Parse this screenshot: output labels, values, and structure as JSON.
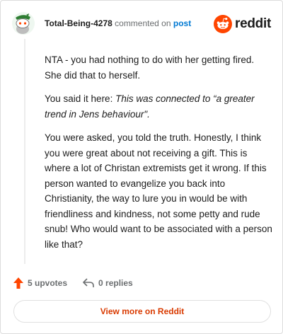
{
  "header": {
    "author": "Total-Being-4278",
    "action": "commented on",
    "link": "post",
    "brand": "reddit"
  },
  "comment": {
    "p1": "NTA - you had nothing to do with her getting fired. She did that to herself.",
    "p2_prefix": "You said it here: ",
    "p2_quote": "This was connected to “a greater trend in Jens behaviour\".",
    "p3": "You were asked, you told the truth. Honestly, I think you were great about not receiving a gift. This is where a lot of Christan extremists get it wrong. If this person wanted to evangelize you back into Christianity, the way to lure you in would be with friendliness and kindness, not some petty and rude snub! Who would want to be associated with a person like that?"
  },
  "footer": {
    "upvotes": "5 upvotes",
    "replies": "0 replies"
  },
  "view_more": "View more on Reddit",
  "colors": {
    "accent": "#ff4500",
    "link": "#0079d3",
    "view_more": "#d93a00"
  },
  "icons": {
    "avatar": "snoo-avatar-icon",
    "brand": "reddit-logo-icon",
    "upvote": "upvote-arrow-icon",
    "reply": "reply-arrow-icon"
  }
}
